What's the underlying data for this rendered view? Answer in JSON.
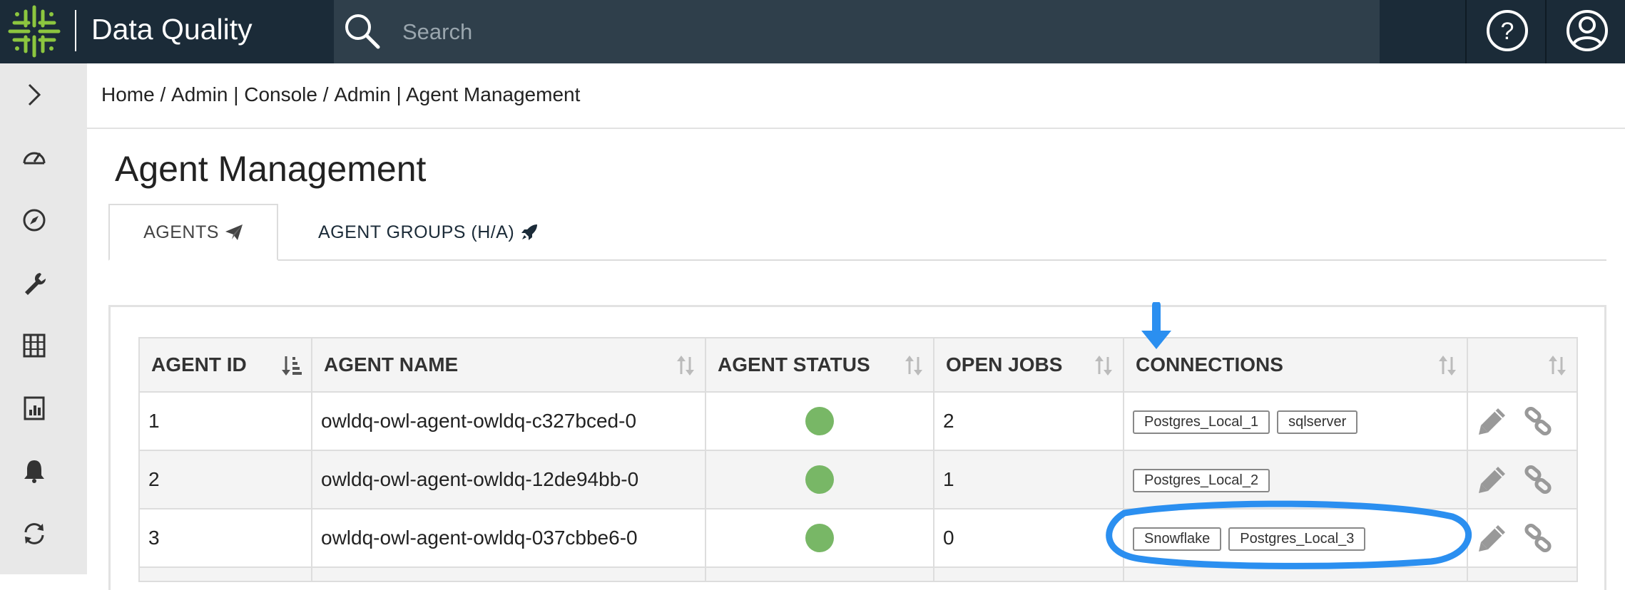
{
  "app": {
    "title": "Data Quality"
  },
  "search": {
    "placeholder": "Search"
  },
  "breadcrumb": {
    "home": "Home",
    "sep": " / ",
    "console": "Admin | Console",
    "current": "Admin | Agent Management"
  },
  "page": {
    "title": "Agent Management"
  },
  "tabs": [
    {
      "label": "AGENTS",
      "icon": "paper-plane-icon",
      "active": true
    },
    {
      "label": "AGENT GROUPS (H/A)",
      "icon": "rocket-icon",
      "active": false
    }
  ],
  "sidebar": {
    "items": [
      "expand-icon",
      "dashboard-gauge-icon",
      "compass-icon",
      "wrench-icon",
      "catalog-icon",
      "report-icon",
      "bell-icon",
      "sync-icon"
    ]
  },
  "table": {
    "headers": {
      "agent_id": "AGENT ID",
      "agent_name": "AGENT NAME",
      "agent_status": "AGENT STATUS",
      "open_jobs": "OPEN JOBS",
      "connections": "CONNECTIONS"
    },
    "rows": [
      {
        "id": "1",
        "name": "owldq-owl-agent-owldq-c327bced-0",
        "status": "online",
        "open_jobs": "2",
        "connections": [
          "Postgres_Local_1",
          "sqlserver"
        ]
      },
      {
        "id": "2",
        "name": "owldq-owl-agent-owldq-12de94bb-0",
        "status": "online",
        "open_jobs": "1",
        "connections": [
          "Postgres_Local_2"
        ]
      },
      {
        "id": "3",
        "name": "owldq-owl-agent-owldq-037cbbe6-0",
        "status": "online",
        "open_jobs": "0",
        "connections": [
          "Snowflake",
          "Postgres_Local_3"
        ]
      }
    ]
  },
  "colors": {
    "topbar": "#1b2b38",
    "search_bg": "#2f3f4b",
    "logo_green": "#8cc63f",
    "status_online": "#78b766",
    "annotation_blue": "#2b8ff0"
  }
}
